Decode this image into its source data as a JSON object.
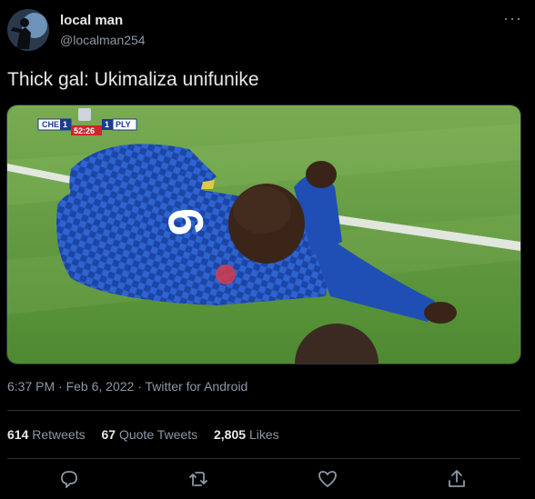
{
  "tweet": {
    "author_name": "local man",
    "author_handle": "@localman254",
    "text": "Thick gal: Ukimaliza unifunike",
    "timestamp": "6:37 PM · Feb 6, 2022",
    "source": "Twitter for Android"
  },
  "scoreboard": {
    "home_team": "CHE",
    "home_score": "1",
    "away_score": "1",
    "away_team": "PLY",
    "clock": "52:26"
  },
  "jersey_number": "9",
  "stats": {
    "retweets_count": "614",
    "retweets_label": "Retweets",
    "quote_count": "67",
    "quote_label": "Quote Tweets",
    "likes_count": "2,805",
    "likes_label": "Likes"
  },
  "icons": [
    "more-icon",
    "reply-icon",
    "retweet-icon",
    "like-icon",
    "share-icon"
  ],
  "colors": {
    "background": "#000000",
    "text_primary": "#e7e9ea",
    "text_secondary": "#8b98a5",
    "divider": "#2f3336",
    "jersey_blue": "#1f4fb4",
    "pitch_green": "#5e9a3c"
  }
}
